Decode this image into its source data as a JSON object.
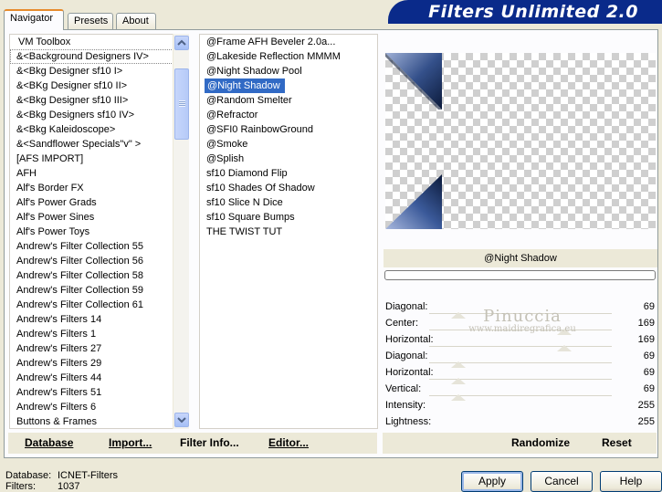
{
  "app": {
    "title": "Filters Unlimited 2.0"
  },
  "tabs": [
    {
      "label": "Navigator"
    },
    {
      "label": "Presets"
    },
    {
      "label": "About"
    }
  ],
  "categories": [
    "VM Toolbox",
    "&<Background Designers IV>",
    "&<Bkg Designer sf10 I>",
    "&<BKg Designer sf10 II>",
    "&<Bkg Designer sf10 III>",
    "&<Bkg Designers sf10 IV>",
    "&<Bkg Kaleidoscope>",
    "&<Sandflower Specials\"v\" >",
    "[AFS IMPORT]",
    "AFH",
    "Alf's Border FX",
    "Alf's Power Grads",
    "Alf's Power Sines",
    "Alf's Power Toys",
    "Andrew's Filter Collection 55",
    "Andrew's Filter Collection 56",
    "Andrew's Filter Collection 58",
    "Andrew's Filter Collection 59",
    "Andrew's Filter Collection 61",
    "Andrew's Filters 14",
    "Andrew's Filters 1",
    "Andrew's Filters 27",
    "Andrew's Filters 29",
    "Andrew's Filters 44",
    "Andrew's Filters 51",
    "Andrew's Filters 6",
    "Buttons & Frames"
  ],
  "filters": [
    "@Frame AFH Beveler 2.0a...",
    "@Lakeside Reflection MMMM",
    "@Night Shadow Pool",
    "@Night Shadow",
    "@Random Smelter",
    "@Refractor",
    "@SFI0 RainbowGround",
    "@Smoke",
    "@Splish",
    "sf10 Diamond Flip",
    "sf10 Shades Of Shadow",
    "sf10 Slice N Dice",
    "sf10 Square Bumps",
    "THE TWIST TUT"
  ],
  "selected_filter_name": "@Night Shadow",
  "params": [
    {
      "label": "Diagonal:",
      "value": "69"
    },
    {
      "label": "Center:",
      "value": "169"
    },
    {
      "label": "Horizontal:",
      "value": "169"
    },
    {
      "label": "Diagonal:",
      "value": "69"
    },
    {
      "label": "Horizontal:",
      "value": "69"
    },
    {
      "label": "Vertical:",
      "value": "69"
    },
    {
      "label": "Intensity:",
      "value": "255"
    },
    {
      "label": "Lightness:",
      "value": "255"
    }
  ],
  "toolbar": {
    "database": "Database",
    "import": "Import...",
    "filter_info": "Filter Info...",
    "editor": "Editor...",
    "randomize": "Randomize",
    "reset": "Reset"
  },
  "status": {
    "database_label": "Database:",
    "database_value": "ICNET-Filters",
    "filters_label": "Filters:",
    "filters_value": "1037"
  },
  "buttons": {
    "apply": "Apply",
    "cancel": "Cancel",
    "help": "Help"
  },
  "watermark": {
    "line1": "Pinuccia",
    "line2": "www.maidiregrafica.eu"
  },
  "colors": {
    "banner": "#0a2a8a",
    "selection": "#316ac5"
  }
}
